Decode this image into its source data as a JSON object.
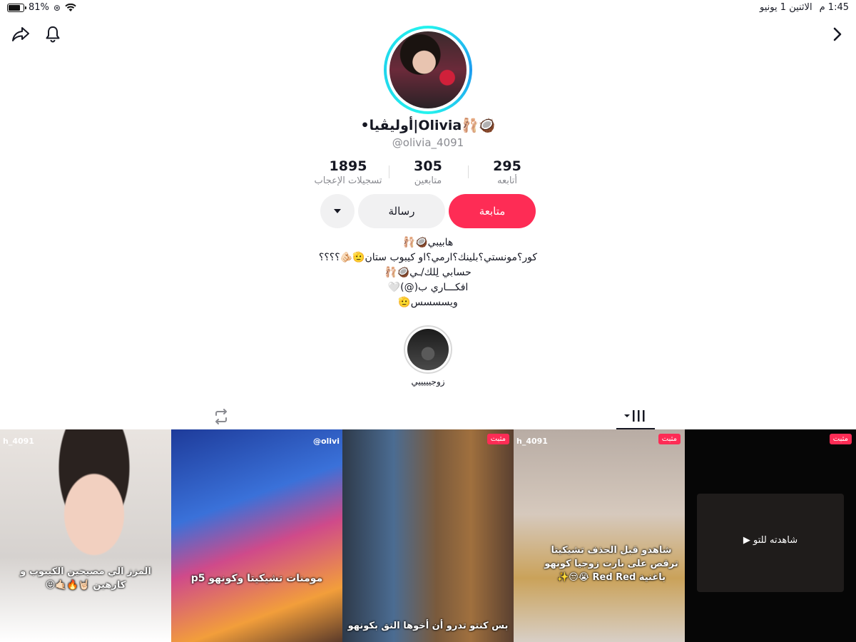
{
  "status_bar": {
    "time": "1:45",
    "ampm": "م",
    "date": "الاثنين 1 يونيو",
    "battery_text": "81%",
    "battery_level": 0.81
  },
  "profile": {
    "display_name": "•أوليڤيا|Olivia🩰🥥",
    "username": "@olivia_4091",
    "stats": [
      {
        "value": "295",
        "label": "أتابعه"
      },
      {
        "value": "305",
        "label": "متابعين"
      },
      {
        "value": "1895",
        "label": "تسجيلات الإعجاب"
      }
    ],
    "buttons": {
      "follow": "متابعة",
      "message": "رسالة"
    },
    "bio_lines": [
      "هابيبي🥥🩰",
      "كور؟مونستي؟بلينك؟ارمي؟او كيبوب ستان🫡🫵🏻؟؟؟؟",
      "حسابي لِلك/ـي🥥🩰",
      "افكـــاري ب(@)🤍",
      "ويسسسس🫡"
    ],
    "highlight_label": "زوجيييييي"
  },
  "colors": {
    "accent": "#fe2c55",
    "secondary_button": "#f1f1f2",
    "muted_text": "#8a8b91"
  },
  "grid": {
    "pinned_label": "مثبت",
    "tiles": [
      {
        "handle": "h_4091",
        "caption": "المزز الي مصيحين الكيبوب و كارهين 🤘🏻🔥🤙🏻😝"
      },
      {
        "handle": "@olivi",
        "caption": "مومنات تشيكيتا وكونهو p5"
      },
      {
        "handle": "",
        "caption": "بس كنتو تدرو أن أخوها التق بكونهو"
      },
      {
        "handle": "h_4091",
        "caption": "شاهدو قبل الحذف تشيكيتا ترقص على بارت زوجيا كونهو باغنية Red Red 😭😒✨"
      },
      {
        "handle": "",
        "caption": "شاهدته للتو ▶"
      }
    ]
  }
}
